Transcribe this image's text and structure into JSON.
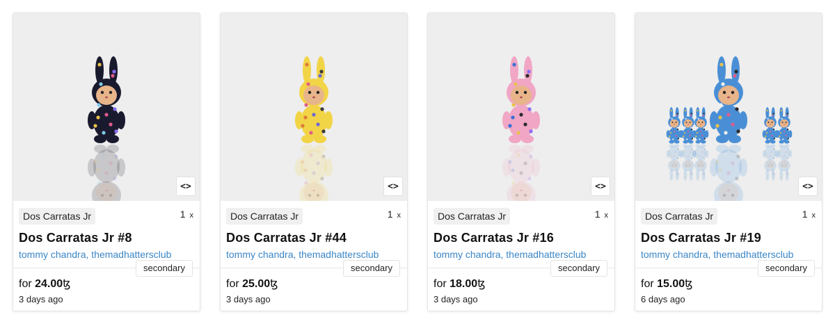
{
  "cards": [
    {
      "collection": "Dos Carratas Jr",
      "edition_count": "1",
      "edition_suffix": "x",
      "title": "Dos Carratas Jr #8",
      "artists": "tommy chandra, themadhattersclub",
      "market": "secondary",
      "price_prefix": "for",
      "price": "24.00",
      "currency": "ꜩ",
      "time": "3 days ago",
      "embed_label": "<>",
      "figure": {
        "body": "#1a1a2e",
        "dots": [
          "#e8c24a",
          "#e05c8a",
          "#7fc8e8",
          "#8b6cf0"
        ],
        "crowd": false
      }
    },
    {
      "collection": "Dos Carratas Jr",
      "edition_count": "1",
      "edition_suffix": "x",
      "title": "Dos Carratas Jr #44",
      "artists": "tommy chandra, themadhattersclub",
      "market": "secondary",
      "price_prefix": "for",
      "price": "25.00",
      "currency": "ꜩ",
      "time": "3 days ago",
      "embed_label": "<>",
      "figure": {
        "body": "#f2d447",
        "dots": [
          "#e07a3c",
          "#6b6bd6",
          "#e05c8a",
          "#3a3a3a"
        ],
        "crowd": false
      }
    },
    {
      "collection": "Dos Carratas Jr",
      "edition_count": "1",
      "edition_suffix": "x",
      "title": "Dos Carratas Jr #16",
      "artists": "tommy chandra, themadhattersclub",
      "market": "secondary",
      "price_prefix": "for",
      "price": "18.00",
      "currency": "ꜩ",
      "time": "3 days ago",
      "embed_label": "<>",
      "figure": {
        "body": "#f0a6c4",
        "dots": [
          "#3b6fd6",
          "#2a2a2a",
          "#e8c24a",
          "#8b6cf0"
        ],
        "crowd": false
      }
    },
    {
      "collection": "Dos Carratas Jr",
      "edition_count": "1",
      "edition_suffix": "x",
      "title": "Dos Carratas Jr #19",
      "artists": "tommy chandra, themadhattersclub",
      "market": "secondary",
      "price_prefix": "for",
      "price": "15.00",
      "currency": "ꜩ",
      "time": "6 days ago",
      "embed_label": "<>",
      "figure": {
        "body": "#4a8fd6",
        "dots": [
          "#e8c24a",
          "#e05c8a",
          "#f2f2f2",
          "#2a2a2a"
        ],
        "crowd": true
      }
    }
  ]
}
